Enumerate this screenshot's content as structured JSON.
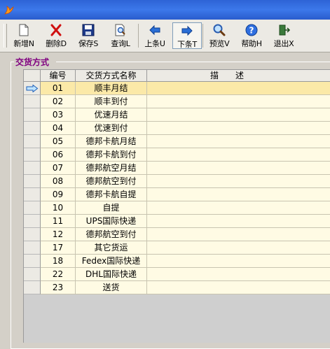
{
  "window": {
    "icon": "app-flame-icon",
    "title_bar_color": "#3069dc"
  },
  "toolbar": {
    "buttons": [
      {
        "id": "new",
        "label": "新增N",
        "icon": "new-document-icon"
      },
      {
        "id": "delete",
        "label": "删除D",
        "icon": "delete-x-icon"
      },
      {
        "id": "save",
        "label": "保存S",
        "icon": "save-disk-icon"
      },
      {
        "id": "query",
        "label": "查询L",
        "icon": "query-magnifier-doc-icon"
      },
      {
        "id": "prev",
        "label": "上条U",
        "icon": "arrow-left-icon"
      },
      {
        "id": "next",
        "label": "下条T",
        "icon": "arrow-right-icon"
      },
      {
        "id": "preview",
        "label": "预览V",
        "icon": "preview-magnifier-icon"
      },
      {
        "id": "help",
        "label": "帮助H",
        "icon": "help-question-icon"
      },
      {
        "id": "exit",
        "label": "退出X",
        "icon": "exit-door-icon"
      }
    ]
  },
  "section_title": "交货方式",
  "grid": {
    "headers": {
      "code": "编号",
      "name": "交货方式名称",
      "desc": "描　　述"
    },
    "selected_index": 0,
    "rows": [
      {
        "code": "01",
        "name": "顺丰月结",
        "desc": ""
      },
      {
        "code": "02",
        "name": "顺丰到付",
        "desc": ""
      },
      {
        "code": "03",
        "name": "优速月结",
        "desc": ""
      },
      {
        "code": "04",
        "name": "优速到付",
        "desc": ""
      },
      {
        "code": "05",
        "name": "德邦卡航月结",
        "desc": ""
      },
      {
        "code": "06",
        "name": "德邦卡航到付",
        "desc": ""
      },
      {
        "code": "07",
        "name": "德邦航空月结",
        "desc": ""
      },
      {
        "code": "08",
        "name": "德邦航空到付",
        "desc": ""
      },
      {
        "code": "09",
        "name": "德邦卡航自提",
        "desc": ""
      },
      {
        "code": "10",
        "name": "自提",
        "desc": ""
      },
      {
        "code": "11",
        "name": "UPS国际快递",
        "desc": ""
      },
      {
        "code": "12",
        "name": "德邦航空到付",
        "desc": ""
      },
      {
        "code": "17",
        "name": "其它货运",
        "desc": ""
      },
      {
        "code": "18",
        "name": "Fedex国际快递",
        "desc": ""
      },
      {
        "code": "22",
        "name": "DHL国际快递",
        "desc": ""
      },
      {
        "code": "23",
        "name": "送货",
        "desc": ""
      }
    ]
  },
  "colors": {
    "section_title": "#800080",
    "cell_bg": "#fffbe4",
    "selected_row_bg": "#fbe9a8"
  }
}
